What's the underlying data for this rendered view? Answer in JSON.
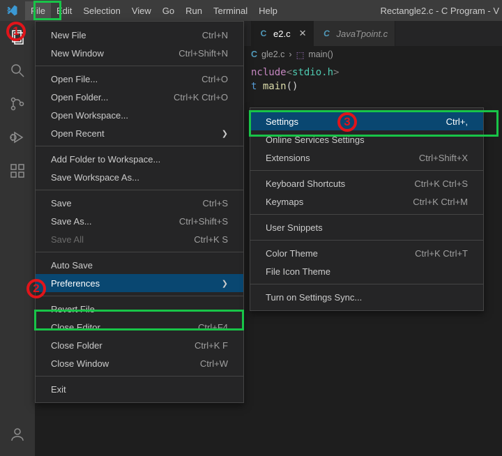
{
  "menubar": {
    "items": [
      "File",
      "Edit",
      "Selection",
      "View",
      "Go",
      "Run",
      "Terminal",
      "Help"
    ],
    "title": "Rectangle2.c - C Program - V"
  },
  "tabs": {
    "active": {
      "icon": "C",
      "label": "e2.c"
    },
    "inactive": {
      "icon": "C",
      "label": "JavaTpoint.c"
    }
  },
  "breadcrumb": {
    "file": "gle2.c",
    "func": "main()"
  },
  "code": {
    "line1_kw": "nclude",
    "line1_lib": "stdio.h",
    "line2_type": "t ",
    "line2_fn": "main",
    "line2_paren": "()"
  },
  "file_menu": [
    {
      "label": "New File",
      "shortcut": "Ctrl+N",
      "type": "item"
    },
    {
      "label": "New Window",
      "shortcut": "Ctrl+Shift+N",
      "type": "item"
    },
    {
      "type": "sep"
    },
    {
      "label": "Open File...",
      "shortcut": "Ctrl+O",
      "type": "item"
    },
    {
      "label": "Open Folder...",
      "shortcut": "Ctrl+K Ctrl+O",
      "type": "item"
    },
    {
      "label": "Open Workspace...",
      "type": "item"
    },
    {
      "label": "Open Recent",
      "type": "submenu"
    },
    {
      "type": "sep"
    },
    {
      "label": "Add Folder to Workspace...",
      "type": "item"
    },
    {
      "label": "Save Workspace As...",
      "type": "item"
    },
    {
      "type": "sep"
    },
    {
      "label": "Save",
      "shortcut": "Ctrl+S",
      "type": "item"
    },
    {
      "label": "Save As...",
      "shortcut": "Ctrl+Shift+S",
      "type": "item"
    },
    {
      "label": "Save All",
      "shortcut": "Ctrl+K S",
      "type": "item",
      "disabled": true
    },
    {
      "type": "sep"
    },
    {
      "label": "Auto Save",
      "type": "item"
    },
    {
      "label": "Preferences",
      "type": "submenu",
      "highlight": true
    },
    {
      "type": "sep"
    },
    {
      "label": "Revert File",
      "type": "item"
    },
    {
      "label": "Close Editor",
      "shortcut": "Ctrl+F4",
      "type": "item"
    },
    {
      "label": "Close Folder",
      "shortcut": "Ctrl+K F",
      "type": "item"
    },
    {
      "label": "Close Window",
      "shortcut": "Ctrl+W",
      "type": "item"
    },
    {
      "type": "sep"
    },
    {
      "label": "Exit",
      "type": "item"
    }
  ],
  "pref_menu": [
    {
      "label": "Settings",
      "shortcut": "Ctrl+,",
      "type": "item",
      "highlight": true
    },
    {
      "label": "Online Services Settings",
      "type": "item"
    },
    {
      "label": "Extensions",
      "shortcut": "Ctrl+Shift+X",
      "type": "item"
    },
    {
      "type": "sep"
    },
    {
      "label": "Keyboard Shortcuts",
      "shortcut": "Ctrl+K Ctrl+S",
      "type": "item"
    },
    {
      "label": "Keymaps",
      "shortcut": "Ctrl+K Ctrl+M",
      "type": "item"
    },
    {
      "type": "sep"
    },
    {
      "label": "User Snippets",
      "type": "item"
    },
    {
      "type": "sep"
    },
    {
      "label": "Color Theme",
      "shortcut": "Ctrl+K Ctrl+T",
      "type": "item"
    },
    {
      "label": "File Icon Theme",
      "type": "item"
    },
    {
      "type": "sep"
    },
    {
      "label": "Turn on Settings Sync...",
      "type": "item"
    }
  ],
  "annotations": {
    "n1": "1",
    "n2": "2",
    "n3": "3"
  }
}
